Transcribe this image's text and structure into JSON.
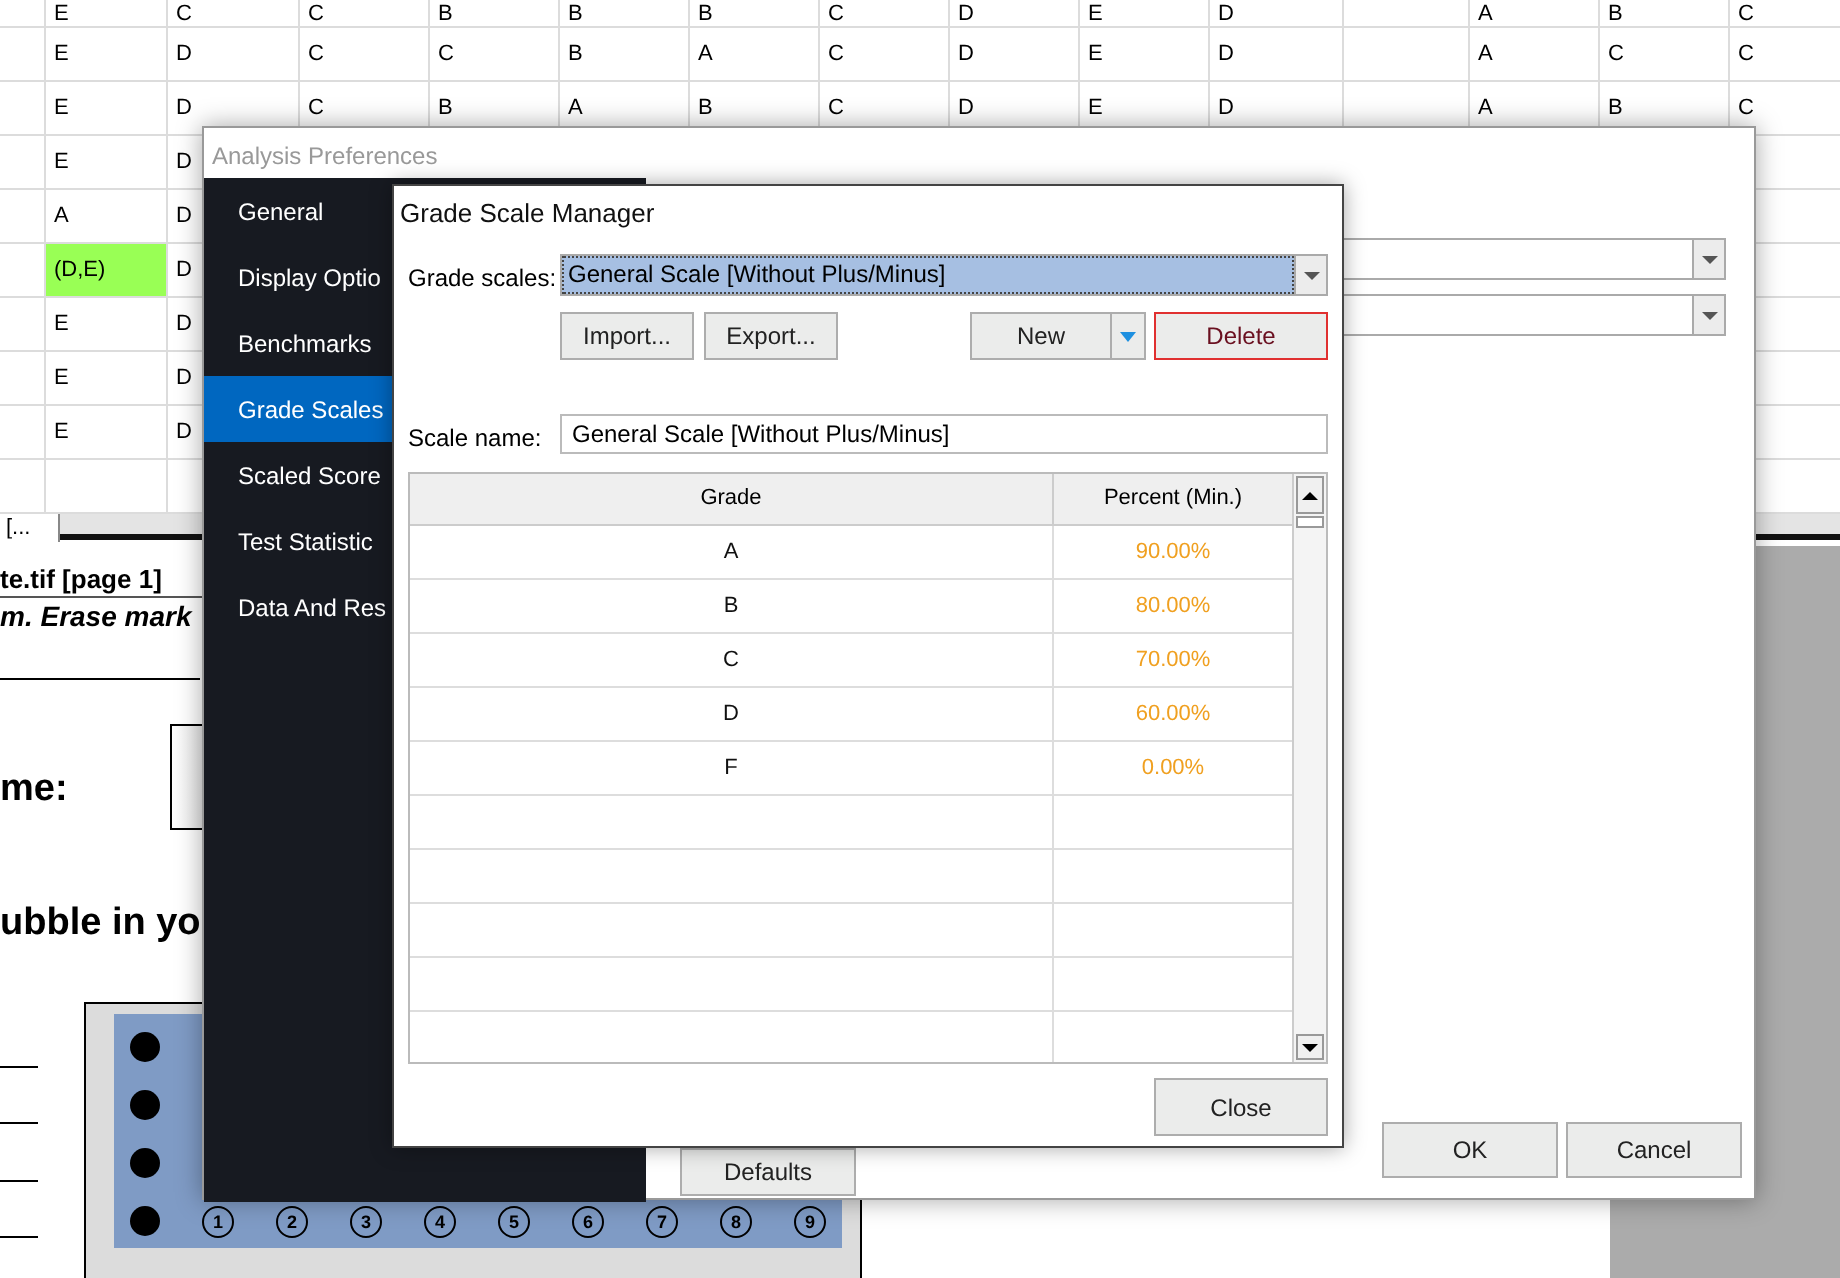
{
  "sheet": {
    "rows": [
      {
        "cells": [
          "E",
          "C",
          "C",
          "B",
          "B",
          "B",
          "C",
          "D",
          "E",
          "D"
        ],
        "right_cells": [
          "A",
          "B",
          "C"
        ],
        "highlighted": false
      },
      {
        "cells": [
          "E",
          "D",
          "C",
          "C",
          "B",
          "A",
          "C",
          "D",
          "E",
          "D"
        ],
        "right_cells": [
          "A",
          "C",
          "C"
        ],
        "highlighted": false
      },
      {
        "cells": [
          "E",
          "D",
          "C",
          "B",
          "A",
          "B",
          "C",
          "D",
          "E",
          "D"
        ],
        "right_cells": [
          "A",
          "B",
          "C"
        ],
        "highlighted": false
      },
      {
        "cells": [
          "E",
          "D"
        ],
        "highlighted": false
      },
      {
        "cells": [
          "A",
          "D"
        ],
        "highlighted": false
      },
      {
        "cells": [
          "(D,E)",
          "D"
        ],
        "highlighted": true
      },
      {
        "cells": [
          "E",
          "D"
        ],
        "highlighted": false
      },
      {
        "cells": [
          "E",
          "D"
        ],
        "highlighted": false
      },
      {
        "cells": [
          "E",
          "D"
        ],
        "highlighted": false
      }
    ],
    "tab": "[..."
  },
  "document": {
    "file_title": "te.tif  [page 1]",
    "instruction": "m. Erase mark",
    "name_label": "me:",
    "bubble_prompt": "ubble in yo",
    "bubble_numbers": [
      "1",
      "2",
      "3",
      "4",
      "5",
      "6",
      "7",
      "8",
      "9"
    ]
  },
  "preferences": {
    "title": "Analysis Preferences",
    "nav": [
      {
        "label": "General",
        "selected": false
      },
      {
        "label": "Display Optio",
        "selected": false
      },
      {
        "label": "Benchmarks",
        "selected": false
      },
      {
        "label": "Grade Scales",
        "selected": true
      },
      {
        "label": "Scaled Score",
        "selected": false
      },
      {
        "label": "Test Statistic",
        "selected": false
      },
      {
        "label": "Data And Res",
        "selected": false
      }
    ],
    "buttons": {
      "defaults": "Defaults",
      "ok": "OK",
      "cancel": "Cancel"
    }
  },
  "grade_scale_manager": {
    "title": "Grade Scale Manager",
    "grade_scales_label": "Grade scales:",
    "grade_scale": "General Scale [Without Plus/Minus]",
    "buttons": {
      "import": "Import...",
      "export": "Export...",
      "new": "New",
      "delete": "Delete",
      "close": "Close"
    },
    "scale_name_label": "Scale name:",
    "scale_name": "General Scale [Without Plus/Minus]",
    "table": {
      "columns": [
        "Grade",
        "Percent (Min.)"
      ],
      "rows": [
        {
          "grade": "A",
          "percent": "90.00%"
        },
        {
          "grade": "B",
          "percent": "80.00%"
        },
        {
          "grade": "C",
          "percent": "70.00%"
        },
        {
          "grade": "D",
          "percent": "60.00%"
        },
        {
          "grade": "F",
          "percent": "0.00%"
        }
      ]
    }
  }
}
